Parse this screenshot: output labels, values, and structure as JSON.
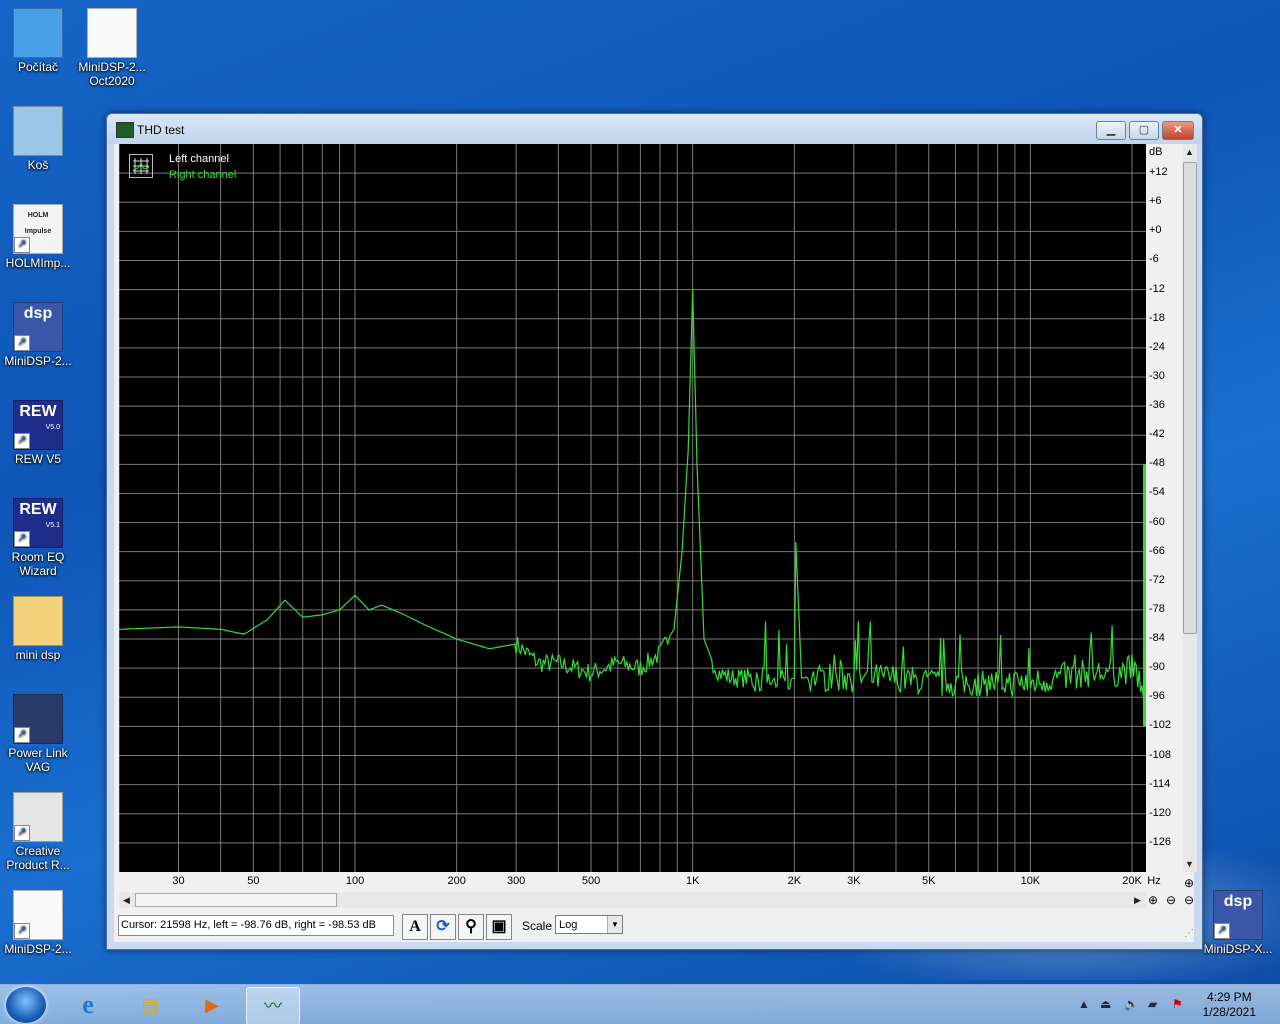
{
  "desktop": {
    "icons": [
      {
        "label": "Počítač",
        "icon": "computer-icon"
      },
      {
        "label": "MiniDSP-2...\nOct2020",
        "icon": "xml-file-icon"
      },
      {
        "label": "Koš",
        "icon": "recycle-bin-icon"
      },
      {
        "label": "HOLMImp...",
        "icon": "holm-impulse-icon",
        "badge": "HOLM Impulse"
      },
      {
        "label": "MiniDSP-2...",
        "icon": "minidsp-icon",
        "badge": "dsp"
      },
      {
        "label": "REW V5",
        "icon": "rew-icon",
        "badge": "REW",
        "sub": "V5.0"
      },
      {
        "label": "Room EQ Wizard",
        "icon": "rew-icon",
        "badge": "REW",
        "sub": "V5.1"
      },
      {
        "label": "mini dsp",
        "icon": "folder-icon"
      },
      {
        "label": "Power Link VAG",
        "icon": "power-link-icon"
      },
      {
        "label": "Creative Product R...",
        "icon": "creative-icon"
      },
      {
        "label": "MiniDSP-2...",
        "icon": "xml-file-icon"
      },
      {
        "label": "MiniDSP-X...",
        "icon": "minidsp-icon",
        "badge": "dsp"
      }
    ]
  },
  "window": {
    "title": "THD test",
    "min_label": "▁",
    "max_label": "▢",
    "close_label": "✕",
    "legend": {
      "left": "Left channel",
      "right": "Right channel"
    },
    "y_unit": "dB",
    "y_ticks": [
      "+12",
      "+6",
      "+0",
      "-6",
      "-12",
      "-18",
      "-24",
      "-30",
      "-36",
      "-42",
      "-48",
      "-54",
      "-60",
      "-66",
      "-72",
      "-78",
      "-84",
      "-90",
      "-96",
      "-102",
      "-108",
      "-114",
      "-120",
      "-126"
    ],
    "x_unit": "Hz",
    "x_ticks": [
      "30",
      "50",
      "100",
      "200",
      "300",
      "500",
      "1K",
      "2K",
      "3K",
      "5K",
      "10K",
      "20K"
    ],
    "cursor_text": "Cursor:  21598 Hz,  left = -98.76 dB,  right = -98.53 dB",
    "scale_label": "Scale",
    "scale_value": "Log",
    "toolbar": {
      "font_btn": "A"
    }
  },
  "chart_data": {
    "type": "line",
    "xscale": "log",
    "xlim": [
      20,
      22000
    ],
    "ylim": [
      -132,
      18
    ],
    "ylabel": "dB",
    "xlabel": "Hz",
    "grid": true,
    "legend_position": "top-left",
    "series": [
      {
        "name": "Left channel",
        "color": "#ffffff",
        "x": [],
        "y": []
      },
      {
        "name": "Right channel",
        "color": "#33dd33",
        "x": [
          20,
          30,
          40,
          47,
          55,
          62,
          70,
          80,
          90,
          100,
          110,
          120,
          140,
          160,
          200,
          250,
          300,
          350,
          400,
          500,
          600,
          700,
          800,
          880,
          930,
          970,
          1000,
          1030,
          1080,
          1150,
          1200,
          1300,
          1500,
          1800,
          2000,
          2020,
          2100,
          3000,
          4000,
          5000,
          6000,
          8000,
          10000,
          12000,
          15000,
          18000,
          20000,
          21000,
          22000
        ],
        "y": [
          -82,
          -81.5,
          -82,
          -83,
          -80,
          -76,
          -79.5,
          -79,
          -78,
          -75,
          -78,
          -77,
          -79,
          -81,
          -84,
          -86,
          -85,
          -89,
          -89,
          -91,
          -89,
          -90,
          -87,
          -82,
          -66,
          -45,
          -12,
          -48,
          -84,
          -89,
          -91,
          -92,
          -92,
          -93,
          -92,
          -64,
          -92,
          -92,
          -92,
          -93,
          -93,
          -93,
          -93,
          -92,
          -91,
          -91,
          -90,
          -92,
          -100
        ]
      }
    ]
  },
  "taskbar": {
    "time": "4:29 PM",
    "date": "1/28/2021"
  }
}
